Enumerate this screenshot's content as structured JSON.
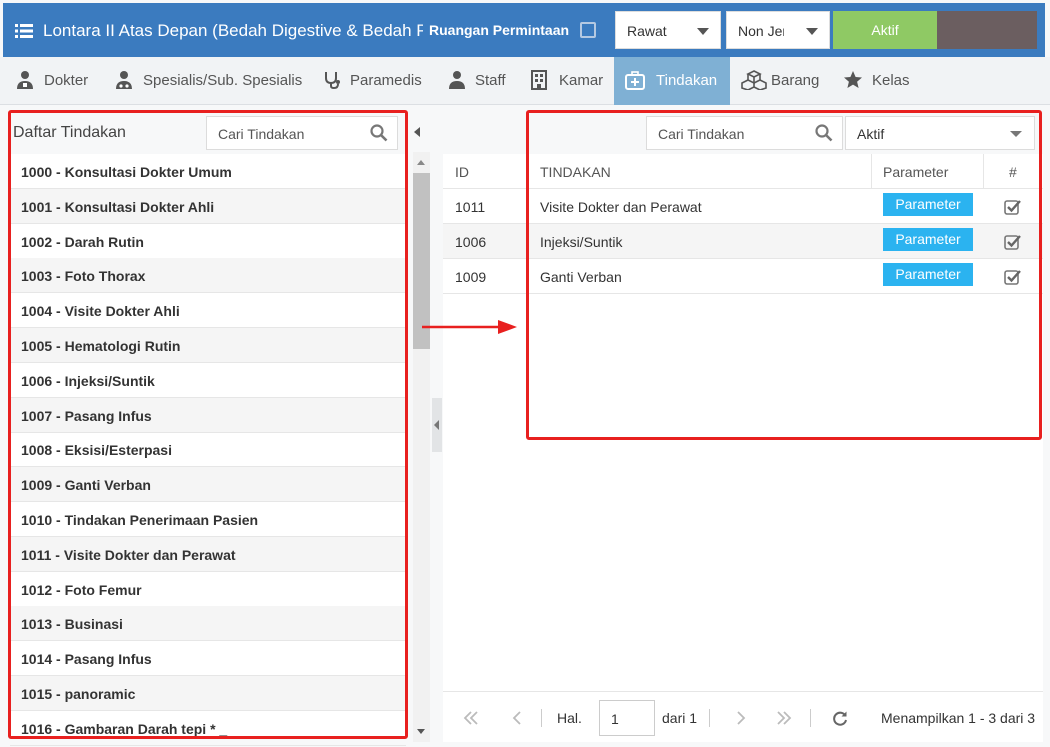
{
  "header": {
    "title": "Lontara II Atas Depan (Bedah Digestive & Bedah Plastik)",
    "ruangan_label": "Ruangan Permintaan",
    "select_rawat": "Rawat",
    "select_jenis": "Non Jenis",
    "aktif_button": "Aktif",
    "accent": "#3b7bbf"
  },
  "tabs": [
    {
      "label": "Dokter",
      "icon": "doctor-icon"
    },
    {
      "label": "Spesialis/Sub. Spesialis",
      "icon": "specialist-icon"
    },
    {
      "label": "Paramedis",
      "icon": "stethoscope-icon"
    },
    {
      "label": "Staff",
      "icon": "user-icon"
    },
    {
      "label": "Kamar",
      "icon": "building-icon"
    },
    {
      "label": "Tindakan",
      "icon": "medkit-icon",
      "active": true
    },
    {
      "label": "Barang",
      "icon": "cubes-icon"
    },
    {
      "label": "Kelas",
      "icon": "star-icon"
    }
  ],
  "left": {
    "title": "Daftar Tindakan",
    "search_placeholder": "Cari Tindakan",
    "items": [
      "1000 - Konsultasi Dokter Umum",
      "1001 - Konsultasi Dokter Ahli",
      "1002 - Darah Rutin",
      "1003 - Foto Thorax",
      "1004 - Visite Dokter Ahli",
      "1005 - Hematologi Rutin",
      "1006 - Injeksi/Suntik",
      "1007 - Pasang Infus",
      "1008 - Eksisi/Esterpasi",
      "1009 - Ganti Verban",
      "1010 - Tindakan Penerimaan Pasien",
      "1011 - Visite Dokter dan Perawat",
      "1012 - Foto Femur",
      "1013 - Businasi",
      "1014 - Pasang Infus",
      "1015 - panoramic",
      "1016 - Gambaran Darah tepi * _"
    ]
  },
  "right": {
    "search_placeholder": "Cari Tindakan",
    "status_select": "Aktif",
    "columns": {
      "id": "ID",
      "tindakan": "TINDAKAN",
      "parameter": "Parameter",
      "check": "#"
    },
    "rows": [
      {
        "id": "1011",
        "tindakan": "Visite Dokter dan Perawat",
        "parameter": "Parameter"
      },
      {
        "id": "1006",
        "tindakan": "Injeksi/Suntik",
        "parameter": "Parameter"
      },
      {
        "id": "1009",
        "tindakan": "Ganti Verban",
        "parameter": "Parameter"
      }
    ]
  },
  "pager": {
    "hal_label": "Hal.",
    "page": "1",
    "of_label": "dari 1",
    "summary": "Menampilkan 1 - 3 dari 3"
  },
  "highlight_color": "#e8201f"
}
